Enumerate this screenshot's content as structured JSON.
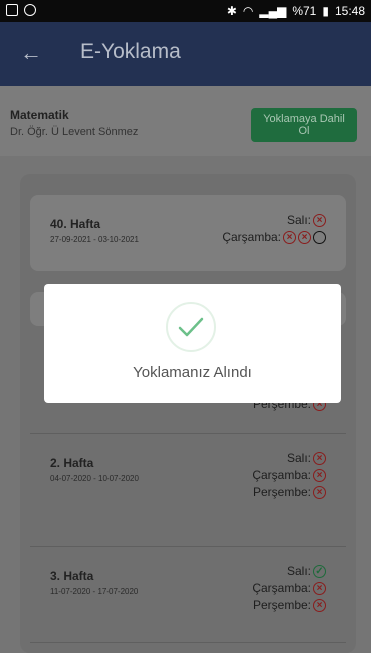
{
  "status_bar": {
    "battery": "%71",
    "time": "15:48"
  },
  "header": {
    "back_icon": "arrow-left-icon",
    "title": "E-Yoklama"
  },
  "course": {
    "name": "Matematik",
    "teacher": "Dr. Öğr. Ü Levent Sönmez",
    "join_button": "Yoklamaya Dahil Ol"
  },
  "weeks": [
    {
      "title": "40. Hafta",
      "dates": "27-09-2021 - 03-10-2021",
      "days": [
        {
          "label": "Salı:",
          "marks": [
            "x"
          ]
        },
        {
          "label": "Çarşamba:",
          "marks": [
            "x",
            "x",
            "empty"
          ]
        }
      ]
    },
    {
      "title": "",
      "dates": "",
      "days": [
        {
          "label": "Perşembe:",
          "marks": [
            "x"
          ]
        }
      ]
    },
    {
      "title": "2. Hafta",
      "dates": "04-07-2020 - 10-07-2020",
      "days": [
        {
          "label": "Salı:",
          "marks": [
            "x"
          ]
        },
        {
          "label": "Çarşamba:",
          "marks": [
            "x"
          ]
        },
        {
          "label": "Perşembe:",
          "marks": [
            "x"
          ]
        }
      ]
    },
    {
      "title": "3. Hafta",
      "dates": "11-07-2020 - 17-07-2020",
      "days": [
        {
          "label": "Salı:",
          "marks": [
            "ok"
          ]
        },
        {
          "label": "Çarşamba:",
          "marks": [
            "x"
          ]
        },
        {
          "label": "Perşembe:",
          "marks": [
            "x"
          ]
        }
      ]
    }
  ],
  "dialog": {
    "icon": "check-circle-icon",
    "message": "Yoklamanız Alındı"
  },
  "colors": {
    "appbar": "#233152",
    "join_button": "#1f6c3e",
    "absent": "#8a1c1c",
    "present": "#1d6a3a"
  }
}
